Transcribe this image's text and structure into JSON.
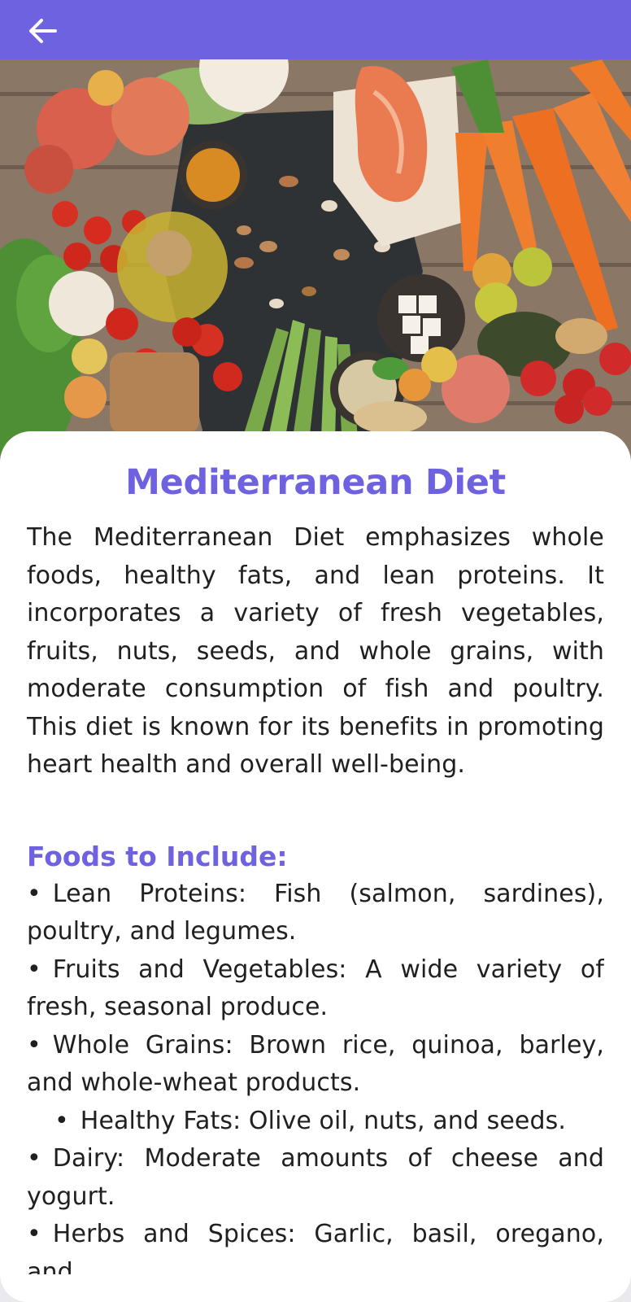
{
  "app_bar": {
    "back_icon": "arrow-left-icon",
    "color": "#6e62e0"
  },
  "hero_image": {
    "subject": "mediterranean-food-flatlay"
  },
  "article": {
    "title": "Mediterranean Diet",
    "description": "The Mediterranean Diet emphasizes whole foods, healthy fats, and lean proteins. It incorporates a variety of fresh vegetables, fruits, nuts, seeds, and whole grains, with moderate consumption of fish and poultry. This diet is known for its benefits in promoting heart health and overall well-being.",
    "foods_heading": "Foods to Include:",
    "bullet": "•",
    "foods": [
      "Lean Proteins: Fish (salmon, sardines), poultry, and legumes.",
      "Fruits and Vegetables: A wide variety of fresh, seasonal produce.",
      "Whole Grains: Brown rice, quinoa, barley, and whole-wheat products.",
      "Healthy Fats: Olive oil, nuts, and seeds.",
      "Dairy: Moderate amounts of cheese and yogurt.",
      "Herbs and Spices: Garlic, basil, oregano, and"
    ],
    "accent_color": "#6e62e0"
  }
}
